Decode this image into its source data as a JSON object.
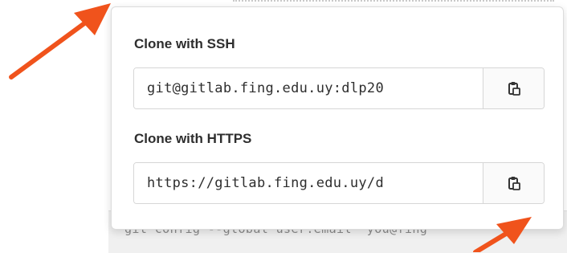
{
  "background": {
    "code_text": "git config --global user.email \"you@fing"
  },
  "clone_dropdown": {
    "ssh": {
      "title": "Clone with SSH",
      "url": "git@gitlab.fing.edu.uy:dlp20",
      "copy_icon": "clipboard-icon"
    },
    "https": {
      "title": "Clone with HTTPS",
      "url": "https://gitlab.fing.edu.uy/d",
      "copy_icon": "clipboard-icon"
    }
  },
  "annotation": {
    "arrow_color": "#f0531c"
  }
}
